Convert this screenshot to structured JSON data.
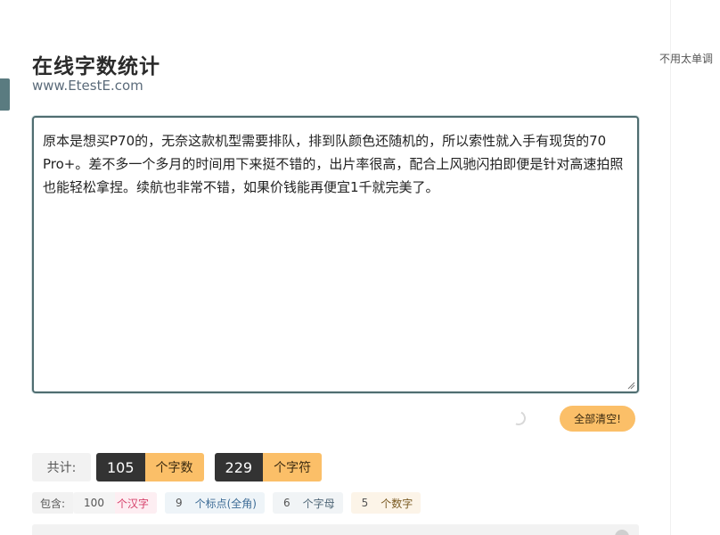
{
  "header": {
    "title": "在线字数统计",
    "subtitle": "www.EtestE.com"
  },
  "side_note": "不用太单调",
  "editor": {
    "content": "原本是想买P70的，无奈这款机型需要排队，排到队颜色还随机的，所以索性就入手有现货的70 Pro+。差不多一个多月的时间用下来挺不错的，出片率很高，配合上风驰闪拍即便是针对高速拍照也能轻松拿捏。续航也非常不错，如果价钱能再便宜1千就完美了。"
  },
  "actions": {
    "clear_label": "全部清空!"
  },
  "stats": {
    "total_label": "共计:",
    "word_count": "105",
    "word_unit": "个字数",
    "char_count": "229",
    "char_unit": "个字符"
  },
  "detail": {
    "label": "包含:",
    "hanzi_count": "100",
    "hanzi_label": "个汉字",
    "punct_count": "9",
    "punct_label": "个标点(全角)",
    "letter_count": "6",
    "letter_label": "个字母",
    "digit_count": "5",
    "digit_label": "个数字"
  },
  "icons": {
    "spinner": "loading-spinner-icon",
    "resize": "resize-grip-icon"
  },
  "colors": {
    "accent": "#fbbf68",
    "dark": "#333333",
    "border": "#4f6d70"
  }
}
